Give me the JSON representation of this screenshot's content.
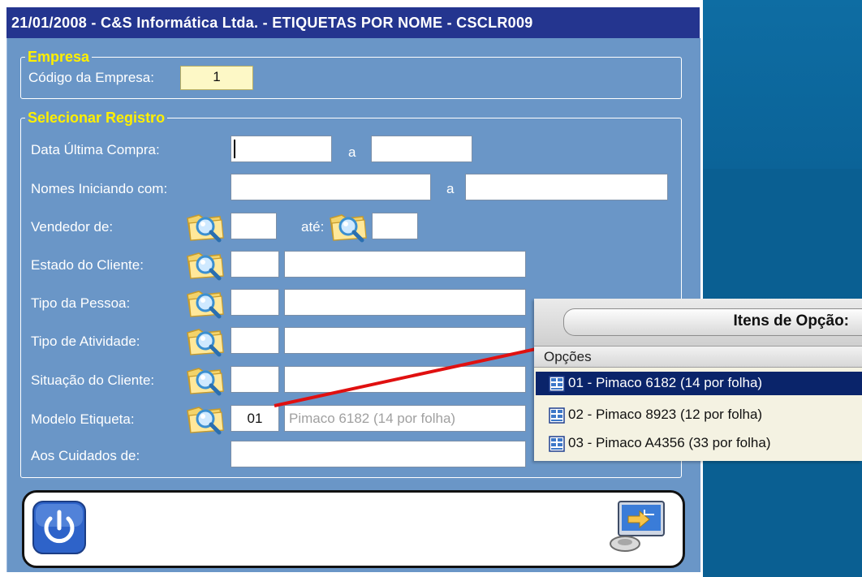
{
  "window": {
    "title": "21/01/2008  -  C&S Informática Ltda.  -  ETIQUETAS POR NOME  -  CSCLR009"
  },
  "empresa": {
    "legend": "Empresa",
    "codigo_label": "Código da Empresa:",
    "codigo_value": "1"
  },
  "selecionar": {
    "legend": "Selecionar Registro",
    "data_label": "Data Última Compra:",
    "data_sep": "a",
    "nomes_label": "Nomes Iniciando com:",
    "nomes_sep": "a",
    "vendedor_label": "Vendedor de:",
    "vendedor_ate": "até:",
    "estado_label": "Estado do Cliente:",
    "tipo_pessoa_label": "Tipo da Pessoa:",
    "tipo_atividade_label": "Tipo de Atividade:",
    "situacao_label": "Situação do Cliente:",
    "modelo_label": "Modelo Etiqueta:",
    "modelo_code": "01",
    "modelo_desc": "Pimaco 6182 (14 por folha)",
    "aos_label": "Aos Cuidados de:"
  },
  "popup": {
    "title": "Itens de Opção:",
    "column": "Opções",
    "options": [
      {
        "label": "01 - Pimaco 6182 (14 por folha)",
        "selected": true
      },
      {
        "label": "02 - Pimaco 8923 (12 por folha)",
        "selected": false
      },
      {
        "label": "03 - Pimaco A4356 (33 por folha)",
        "selected": false
      }
    ]
  },
  "icons": {
    "lookup": "folder-magnifier-icon",
    "exit": "power-icon",
    "confirm": "monitor-transfer-icon",
    "option": "label-sheet-icon"
  },
  "colors": {
    "title_bar": "#24358f",
    "client_bg": "#6a96c7",
    "legend": "#ffef00",
    "selection": "#0a246a",
    "annotation_line": "#e01010"
  }
}
